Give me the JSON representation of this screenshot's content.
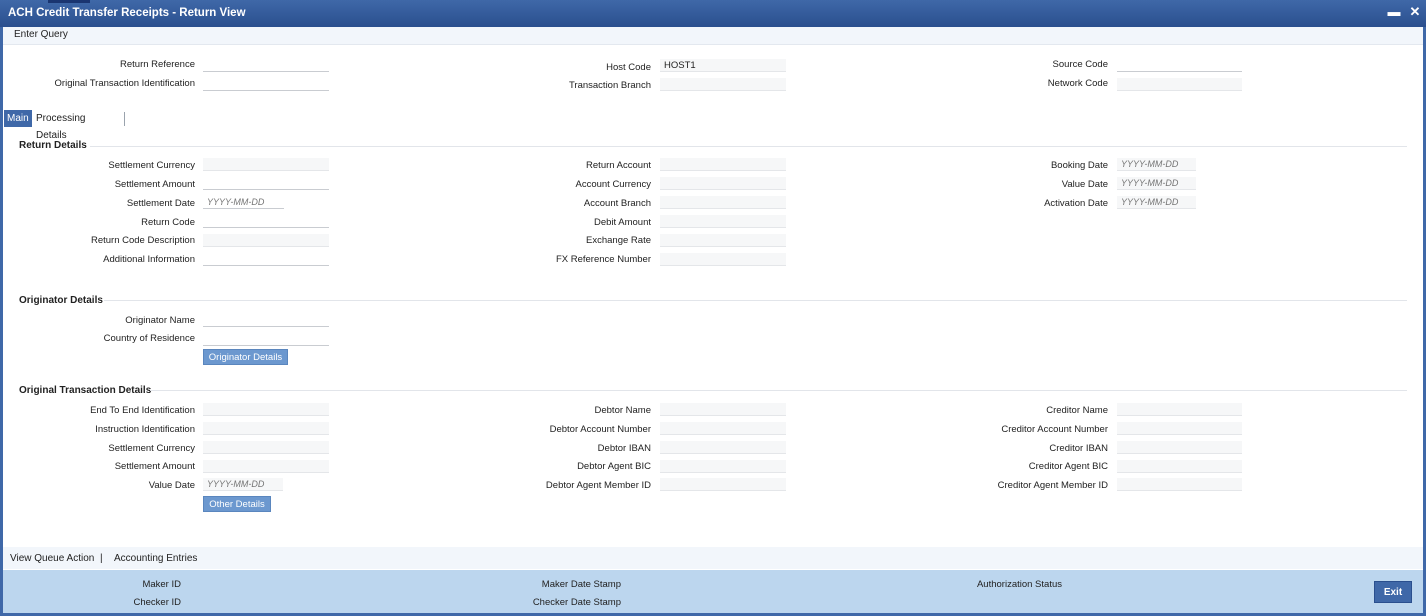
{
  "window": {
    "title": "ACH Credit Transfer Receipts - Return View",
    "minimize_glyph": "▬",
    "close_glyph": "✕"
  },
  "toolbar": {
    "enter_query": "Enter Query"
  },
  "header": {
    "return_reference": {
      "label": "Return Reference",
      "value": ""
    },
    "original_txn_id": {
      "label": "Original Transaction Identification",
      "value": ""
    },
    "host_code": {
      "label": "Host Code",
      "value": "HOST1"
    },
    "transaction_branch": {
      "label": "Transaction Branch",
      "value": ""
    },
    "source_code": {
      "label": "Source Code",
      "value": ""
    },
    "network_code": {
      "label": "Network Code",
      "value": ""
    }
  },
  "tabs": [
    {
      "label": "Main",
      "active": true
    },
    {
      "label": "Processing Details",
      "active": false
    }
  ],
  "return_details": {
    "title": "Return Details",
    "settlement_currency": "Settlement Currency",
    "settlement_amount": "Settlement Amount",
    "settlement_date": "Settlement Date",
    "return_code": "Return Code",
    "return_code_description": "Return Code Description",
    "additional_information": "Additional Information",
    "return_account": "Return Account",
    "account_currency": "Account Currency",
    "account_branch": "Account Branch",
    "debit_amount": "Debit Amount",
    "exchange_rate": "Exchange Rate",
    "fx_reference_number": "FX Reference Number",
    "booking_date": "Booking Date",
    "value_date": "Value Date",
    "activation_date": "Activation Date",
    "date_placeholder": "YYYY-MM-DD"
  },
  "originator_details": {
    "title": "Originator Details",
    "originator_name": "Originator Name",
    "country_of_residence": "Country of Residence",
    "button": "Originator Details"
  },
  "original_txn_details": {
    "title": "Original Transaction Details",
    "end_to_end_id": "End To End Identification",
    "instruction_id": "Instruction Identification",
    "settlement_currency": "Settlement Currency",
    "settlement_amount": "Settlement Amount",
    "value_date": "Value Date",
    "debtor_name": "Debtor Name",
    "debtor_account_number": "Debtor Account Number",
    "debtor_iban": "Debtor IBAN",
    "debtor_agent_bic": "Debtor Agent BIC",
    "debtor_agent_member_id": "Debtor Agent Member ID",
    "creditor_name": "Creditor Name",
    "creditor_account_number": "Creditor Account Number",
    "creditor_iban": "Creditor IBAN",
    "creditor_agent_bic": "Creditor Agent BIC",
    "creditor_agent_member_id": "Creditor Agent Member ID",
    "button": "Other Details",
    "date_placeholder": "YYYY-MM-DD"
  },
  "footer_links": {
    "view_queue_action": "View Queue Action",
    "separator": "|",
    "accounting_entries": "Accounting Entries"
  },
  "status_bar": {
    "maker_id": "Maker ID",
    "checker_id": "Checker ID",
    "maker_date_stamp": "Maker Date Stamp",
    "checker_date_stamp": "Checker Date Stamp",
    "authorization_status": "Authorization Status",
    "exit": "Exit"
  }
}
